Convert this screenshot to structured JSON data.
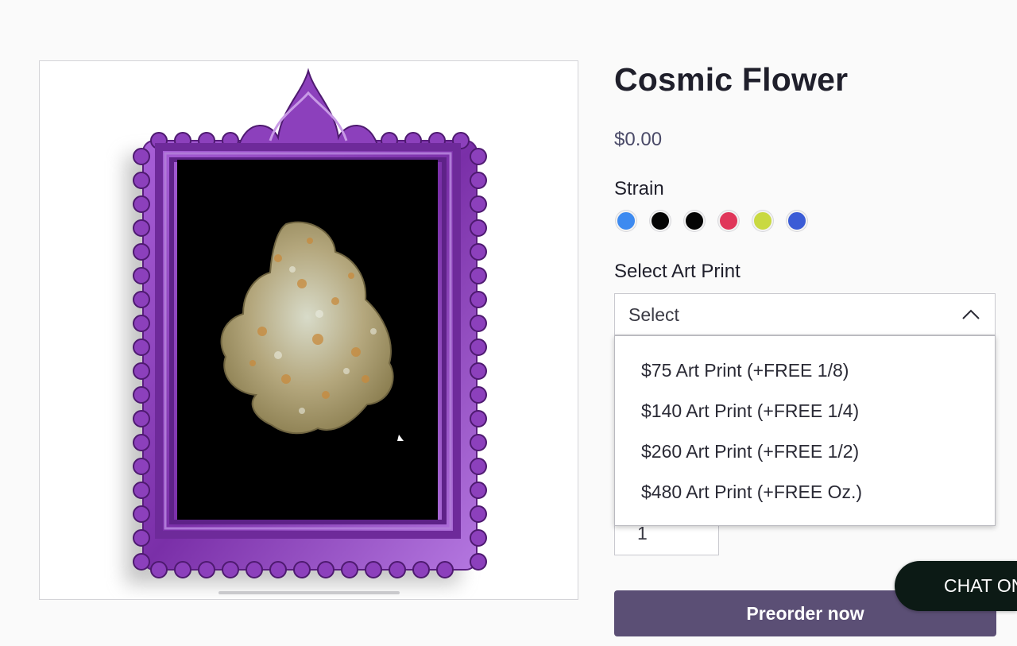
{
  "product": {
    "title": "Cosmic Flower",
    "price": "$0.00"
  },
  "strain": {
    "label": "Strain",
    "swatches": [
      {
        "color": "#3d8af0"
      },
      {
        "color": "#050505"
      },
      {
        "color": "#050505"
      },
      {
        "color": "#e0365a"
      },
      {
        "color": "#c9d941"
      },
      {
        "color": "#3b5cd6"
      }
    ]
  },
  "art_print": {
    "label": "Select Art Print",
    "selected": "Select",
    "options": [
      "$75 Art Print (+FREE 1/8)",
      "$140 Art Print (+FREE 1/4)",
      "$260 Art Print (+FREE 1/2)",
      "$480 Art Print (+FREE Oz.)"
    ]
  },
  "quantity": {
    "value": "1"
  },
  "preorder_button": {
    "label": "Preorder now"
  },
  "chat": {
    "label": "CHAT ON"
  },
  "colors": {
    "accent": "#5b4f75",
    "frame": "#8a3fb8",
    "chat_bg": "#0c1a15"
  },
  "image": {
    "icon": "product-photo-framed-flower"
  }
}
